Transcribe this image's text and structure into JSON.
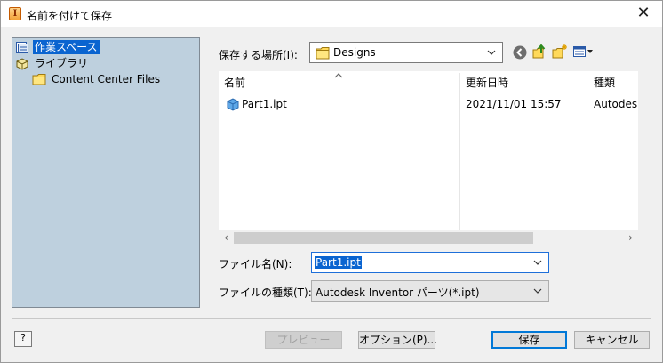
{
  "window": {
    "title": "名前を付けて保存",
    "close_label": "✕"
  },
  "sidebar": {
    "items": [
      {
        "label": "作業スペース",
        "selected": true
      },
      {
        "label": "ライブラリ",
        "selected": false
      },
      {
        "label": "Content Center Files",
        "selected": false
      }
    ]
  },
  "location": {
    "label": "保存する場所(I):",
    "value": "Designs"
  },
  "file_list": {
    "columns": [
      "名前",
      "更新日時",
      "種類"
    ],
    "rows": [
      {
        "name": "Part1.ipt",
        "modified": "2021/11/01 15:57",
        "type": "Autodesk"
      }
    ]
  },
  "filename": {
    "label": "ファイル名(N):",
    "value": "Part1.ipt"
  },
  "filetype": {
    "label": "ファイルの種類(T):",
    "value": "Autodesk Inventor パーツ(*.ipt)"
  },
  "buttons": {
    "help": "?",
    "preview": "プレビュー",
    "options": "オプション(P)...",
    "save": "保存",
    "cancel": "キャンセル"
  },
  "colors": {
    "sidebar_bg": "#bed0de",
    "selection": "#0a64d0",
    "default_button_border": "#0078d7"
  }
}
